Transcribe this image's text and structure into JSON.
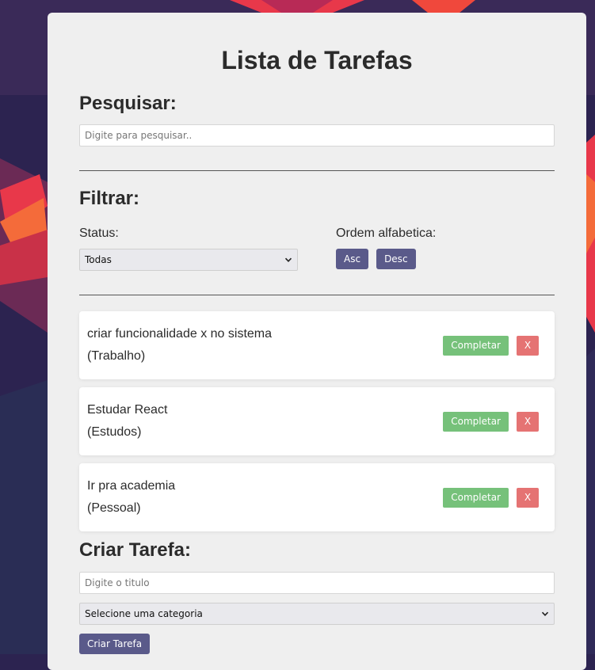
{
  "page": {
    "title": "Lista de Tarefas"
  },
  "search": {
    "heading": "Pesquisar:",
    "placeholder": "Digite para pesquisar.."
  },
  "filter": {
    "heading": "Filtrar:",
    "status_label": "Status:",
    "status_selected": "Todas",
    "order_label": "Ordem alfabetica:",
    "asc_label": "Asc",
    "desc_label": "Desc"
  },
  "todos": [
    {
      "text": "criar funcionalidade x no sistema",
      "category": "(Trabalho)"
    },
    {
      "text": "Estudar React",
      "category": "(Estudos)"
    },
    {
      "text": "Ir pra academia",
      "category": "(Pessoal)"
    }
  ],
  "todo_actions": {
    "complete_label": "Completar",
    "remove_label": "X"
  },
  "create": {
    "heading": "Criar Tarefa:",
    "title_placeholder": "Digite o titulo",
    "category_selected": "Selecione uma categoria",
    "submit_label": "Criar Tarefa"
  },
  "colors": {
    "panel": "#efefef",
    "purple_button": "#5a5a8a",
    "complete_button": "#76c17a",
    "remove_button": "#e57373"
  }
}
